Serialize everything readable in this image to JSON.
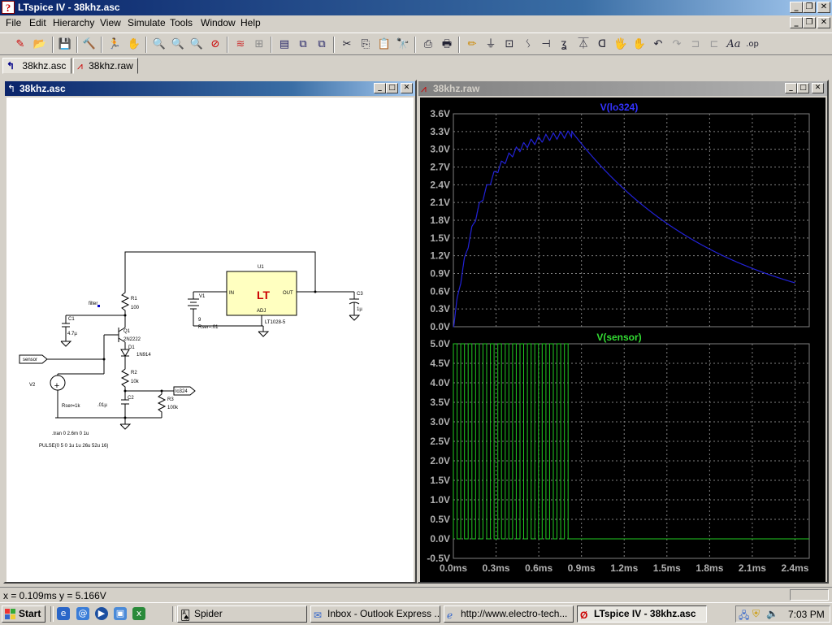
{
  "app": {
    "title": "LTspice IV - 38khz.asc",
    "icon": "ltspice-logo-icon"
  },
  "menu": [
    "File",
    "Edit",
    "Hierarchy",
    "View",
    "Simulate",
    "Tools",
    "Window",
    "Help"
  ],
  "tabs": [
    {
      "label": "38khz.asc",
      "icon": "schematic-icon",
      "active": true
    },
    {
      "label": "38khz.raw",
      "icon": "waveform-icon",
      "active": false
    }
  ],
  "schematic_window": {
    "title": "38khz.asc",
    "labels": {
      "u1": "U1",
      "in": "IN",
      "out": "OUT",
      "adj": "ADJ",
      "u1_part": "LT1028-5",
      "v1": "V1",
      "v1_value": "9",
      "v1_rser": "Rser=.01",
      "c3": "C3",
      "c3_value": "1µ",
      "r1": "R1",
      "r1_value": "100",
      "filter": "filter",
      "c1": "C1",
      "c1_value": "4.7µ",
      "q1": "Q1",
      "q1_part": "2N2222",
      "d1": "D1",
      "d1_part": "1N914",
      "sensor": "sensor",
      "r2": "R2",
      "r2_value": "10k",
      "lo324": "lo324",
      "r3": "R3",
      "r3_value": "100k",
      "c2": "C2",
      "c2_value": ".01µ",
      "v2": "V2",
      "v2_rser": "Rser=1k",
      "tran": ".tran 0 2.6m 0 1u",
      "pulse": "PULSE(0 5 0 1u 1u 26u 52u 16)"
    }
  },
  "waveform_window": {
    "title": "38khz.raw",
    "top_pane": {
      "trace": "V(lo324)",
      "y_ticks": [
        "3.6V",
        "3.3V",
        "3.0V",
        "2.7V",
        "2.4V",
        "2.1V",
        "1.8V",
        "1.5V",
        "1.2V",
        "0.9V",
        "0.6V",
        "0.3V",
        "0.0V"
      ]
    },
    "bottom_pane": {
      "trace": "V(sensor)",
      "y_ticks": [
        "5.0V",
        "4.5V",
        "4.0V",
        "3.5V",
        "3.0V",
        "2.5V",
        "2.0V",
        "1.5V",
        "1.0V",
        "0.5V",
        "0.0V",
        "-0.5V"
      ]
    },
    "x_ticks": [
      "0.0ms",
      "0.3ms",
      "0.6ms",
      "0.9ms",
      "1.2ms",
      "1.5ms",
      "1.8ms",
      "2.1ms",
      "2.4ms"
    ],
    "colors": {
      "background": "#000000",
      "grid": "#808080",
      "top_trace": "#2222d8",
      "bottom_trace": "#22cc22",
      "top_label": "#3333ff",
      "bottom_label": "#33dd33"
    }
  },
  "status": {
    "coords": "x = 0.109ms    y = 5.166V"
  },
  "taskbar": {
    "start": "Start",
    "tasks": [
      {
        "label": "Spider",
        "icon": "spider-icon",
        "active": false
      },
      {
        "label": "Inbox - Outlook Express ...",
        "icon": "outlook-icon",
        "active": false
      },
      {
        "label": "http://www.electro-tech...",
        "icon": "ie-icon",
        "active": false
      },
      {
        "label": "LTspice IV - 38khz.asc",
        "icon": "ltspice-logo-icon",
        "active": true
      }
    ],
    "clock": "7:03 PM"
  }
}
